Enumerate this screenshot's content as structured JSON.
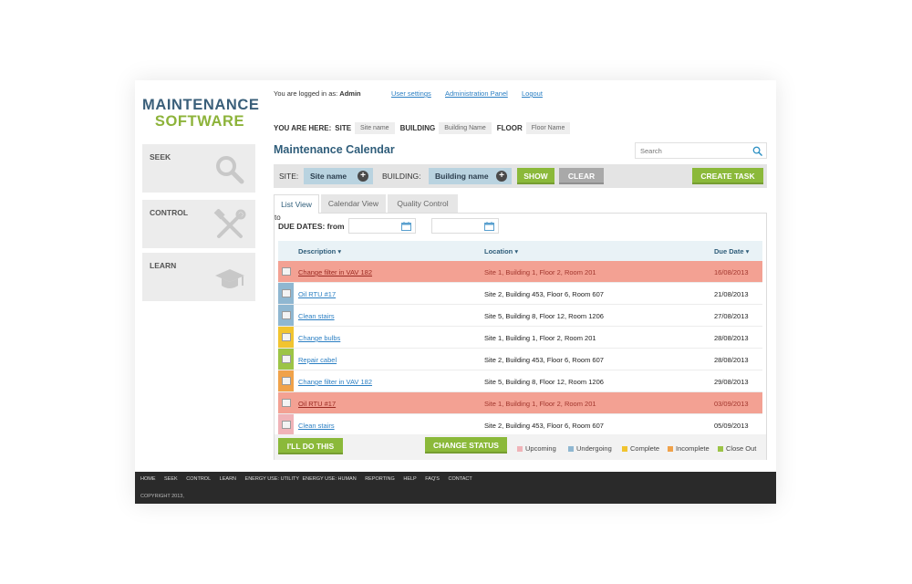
{
  "logo": {
    "line1": "MAINTENANCE",
    "line2": "SOFTWARE"
  },
  "nav": [
    {
      "label": "SEEK",
      "icon": "magnifier-icon"
    },
    {
      "label": "CONTROL",
      "icon": "tools-icon"
    },
    {
      "label": "LEARN",
      "icon": "graduation-cap-icon"
    }
  ],
  "header": {
    "logged_in_prefix": "You are logged in as:",
    "user": "Admin",
    "links": [
      "User settings",
      "Administration Panel",
      "Logout"
    ]
  },
  "breadcrumb": {
    "you_are_here": "YOU ARE HERE:",
    "site_label": "SITE",
    "site_value": "Site name",
    "building_label": "BUILDING",
    "building_value": "Building Name",
    "floor_label": "FLOOR",
    "floor_value": "Floor Name"
  },
  "page_title": "Maintenance Calendar",
  "search": {
    "placeholder": "Search"
  },
  "filter": {
    "site_label": "SITE:",
    "site_value": "Site name",
    "building_label": "BUILDING:",
    "building_value": "Building name",
    "show": "SHOW",
    "clear": "CLEAR",
    "create": "CREATE TASK"
  },
  "tabs": [
    "List View",
    "Calendar View",
    "Quality Control"
  ],
  "due": {
    "label": "DUE DATES: from",
    "to": "to"
  },
  "table": {
    "columns": [
      "Description ▾",
      "Location ▾",
      "Due Date ▾"
    ],
    "rows": [
      {
        "desc": "Change filter in VAV 182",
        "loc": "Site 1, Building 1, Floor 2, Room 201",
        "date": "16/08/2013",
        "status": "overdue"
      },
      {
        "desc": "Oil RTU #17",
        "loc": "Site 2, Building 453, Floor 6, Room 607",
        "date": "21/08/2013",
        "status": "undergoing"
      },
      {
        "desc": "Clean stairs",
        "loc": "Site 5, Building 8, Floor 12, Room 1206",
        "date": "27/08/2013",
        "status": "undergoing"
      },
      {
        "desc": "Change bulbs",
        "loc": "Site 1, Building 1, Floor 2, Room 201",
        "date": "28/08/2013",
        "status": "complete"
      },
      {
        "desc": "Repair cabel",
        "loc": "Site 2, Building 453, Floor 6, Room 607",
        "date": "28/08/2013",
        "status": "closeout"
      },
      {
        "desc": "Change filter in VAV 182",
        "loc": "Site 5, Building 8, Floor 12, Room 1206",
        "date": "29/08/2013",
        "status": "incomplete"
      },
      {
        "desc": "Oil RTU #17",
        "loc": "Site 1, Building 1, Floor 2, Room 201",
        "date": "03/09/2013",
        "status": "overdue"
      },
      {
        "desc": "Clean stairs",
        "loc": "Site 2, Building 453, Floor 6, Room 607",
        "date": "05/09/2013",
        "status": "upcoming"
      }
    ]
  },
  "actions": {
    "ill_do_this": "I'LL DO THIS",
    "change_status": "CHANGE STATUS"
  },
  "legend": [
    {
      "label": "Upcoming",
      "color": "#f0b3b8"
    },
    {
      "label": "Undergoing",
      "color": "#8fb7d1"
    },
    {
      "label": "Complete",
      "color": "#f1c42f"
    },
    {
      "label": "Incomplete",
      "color": "#f0a24a"
    },
    {
      "label": "Close Out",
      "color": "#9cc446"
    }
  ],
  "status_colors": {
    "overdue": "#f3a193",
    "undergoing": "#8fb7d1",
    "complete": "#f1c42f",
    "closeout": "#9cc446",
    "incomplete": "#f0a24a",
    "upcoming": "#f0b3b8"
  },
  "footer": {
    "links": [
      "HOME",
      "SEEK",
      "CONTROL",
      "LEARN",
      "ENERGY USE: UTILITY",
      "ENERGY USE: HUMAN",
      "REPORTING",
      "HELP",
      "FAQ'S",
      "CONTACT"
    ],
    "copyright": "COPYRIGHT 2013,"
  }
}
